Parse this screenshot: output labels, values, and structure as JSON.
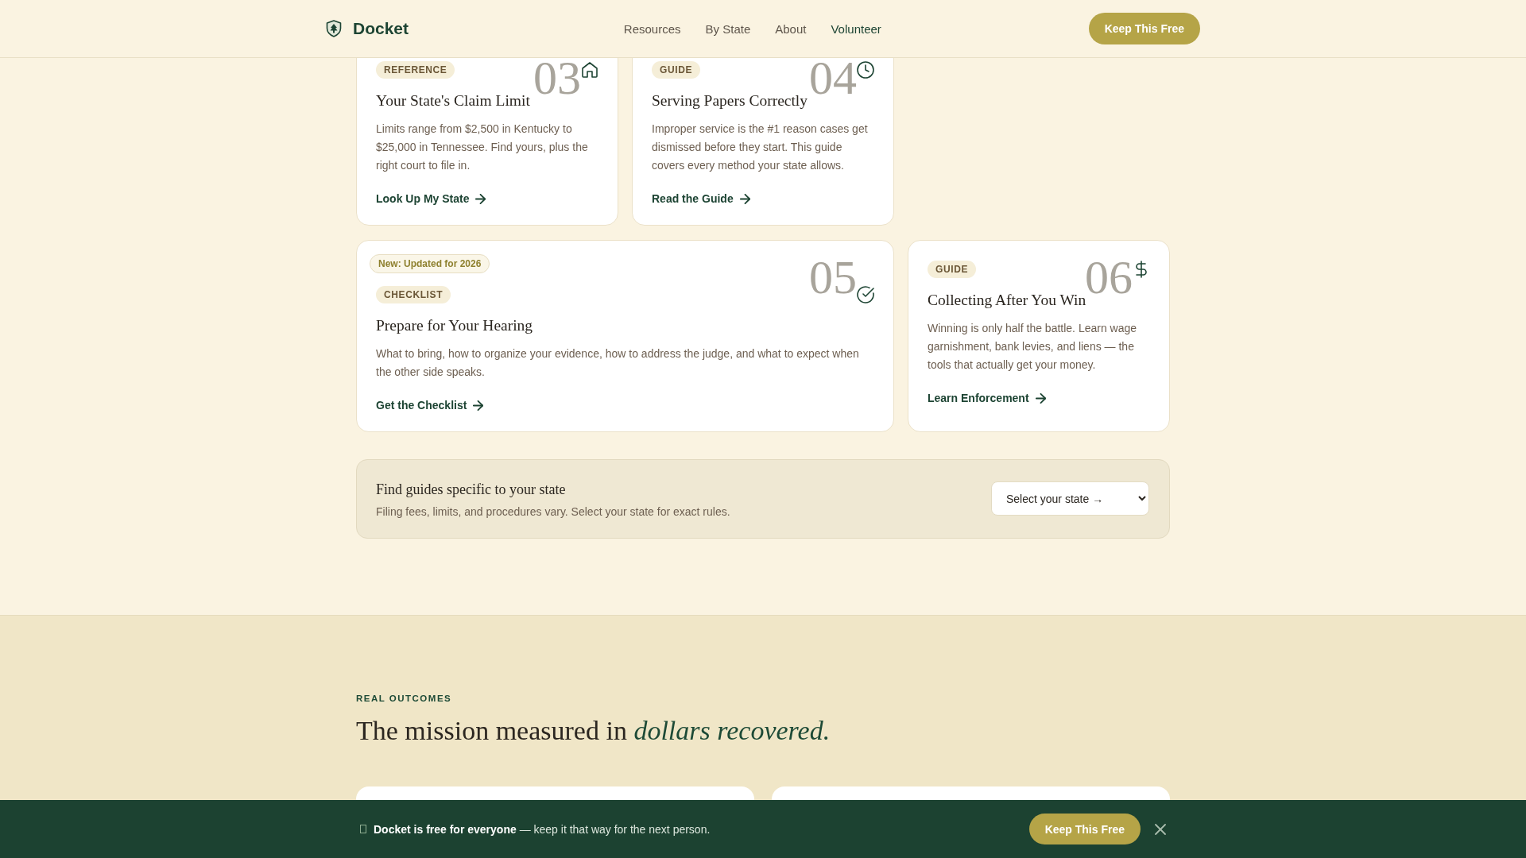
{
  "header": {
    "brand": "Docket",
    "nav": [
      {
        "label": "Resources",
        "selected": false
      },
      {
        "label": "By State",
        "selected": false
      },
      {
        "label": "About",
        "selected": false
      },
      {
        "label": "Volunteer",
        "selected": true
      }
    ],
    "cta": "Keep This Free"
  },
  "guides": [
    {
      "tag": "REFERENCE",
      "number": "03",
      "title": "Your State's Claim Limit",
      "description": "Limits range from $2,500 in Kentucky to $25,000 in Tennessee. Find yours, plus the right court to file in.",
      "link": "Look Up My State"
    },
    {
      "tag": "GUIDE",
      "number": "04",
      "title": "Serving Papers Correctly",
      "description": "Improper service is the #1 reason cases get dismissed before they start. This guide covers every method your state allows.",
      "link": "Read the Guide"
    },
    {
      "notice": "New: Updated for 2026",
      "tag": "CHECKLIST",
      "number": "05",
      "title": "Prepare for Your Hearing",
      "description": "What to bring, how to organize your evidence, how to address the judge, and what to expect when the other side speaks.",
      "link": "Get the Checklist"
    },
    {
      "tag": "GUIDE",
      "number": "06",
      "title": "Collecting After You Win",
      "description": "Winning is only half the battle. Learn wage garnishment, bank levies, and liens — the tools that actually get your money.",
      "link": "Learn Enforcement"
    }
  ],
  "state_finder": {
    "title": "Find guides specific to your state",
    "description": "Filing fees, limits, and procedures vary. Select your state for exact rules.",
    "select": {
      "value": "Select your state →"
    }
  },
  "outcomes": {
    "eyebrow": "REAL OUTCOMES",
    "heading": "The mission measured in *dollars recovered.*"
  },
  "banner": {
    "message": "**Docket is free for everyone** — keep it that way for the next person.",
    "button": "Keep This Free"
  }
}
